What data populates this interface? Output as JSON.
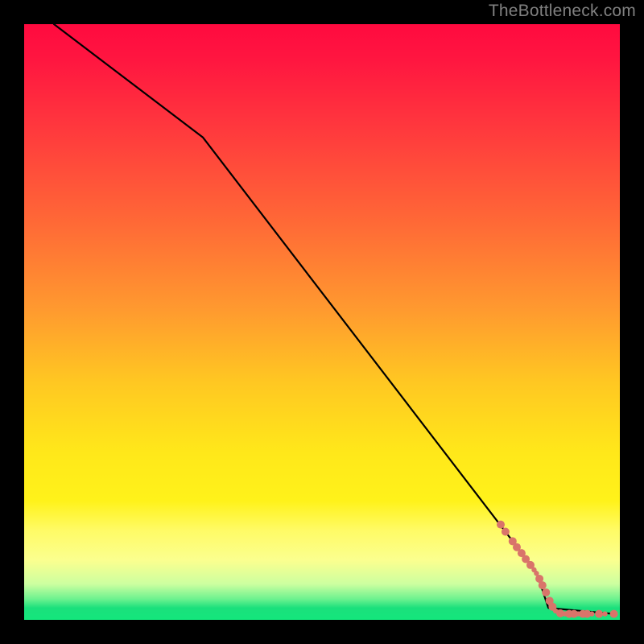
{
  "watermark": "TheBottleneck.com",
  "chart_data": {
    "type": "line",
    "title": "",
    "xlabel": "",
    "ylabel": "",
    "xlim": [
      0,
      100
    ],
    "ylim": [
      0,
      100
    ],
    "grid": false,
    "background_gradient": {
      "direction": "vertical",
      "stops": [
        {
          "pos": 0.0,
          "color": "#ff0a3f"
        },
        {
          "pos": 0.5,
          "color": "#ffb228"
        },
        {
          "pos": 0.8,
          "color": "#fff21a"
        },
        {
          "pos": 0.95,
          "color": "#a8ff9a"
        },
        {
          "pos": 1.0,
          "color": "#14e67c"
        }
      ]
    },
    "series": [
      {
        "name": "curve",
        "color": "#000000",
        "x": [
          5,
          30,
          86,
          88,
          99
        ],
        "y": [
          100,
          81,
          8,
          2,
          1
        ]
      }
    ],
    "scatter": {
      "name": "points",
      "color": "#d9746a",
      "radius_small": 3.2,
      "radius_large": 5.0,
      "points": [
        {
          "x": 80.0,
          "y": 16.0,
          "r": 5.0
        },
        {
          "x": 80.8,
          "y": 14.8,
          "r": 5.0
        },
        {
          "x": 82.0,
          "y": 13.2,
          "r": 5.0
        },
        {
          "x": 82.7,
          "y": 12.2,
          "r": 5.0
        },
        {
          "x": 83.5,
          "y": 11.2,
          "r": 5.0
        },
        {
          "x": 84.2,
          "y": 10.2,
          "r": 5.0
        },
        {
          "x": 85.0,
          "y": 9.2,
          "r": 5.0
        },
        {
          "x": 85.6,
          "y": 8.4,
          "r": 3.2
        },
        {
          "x": 86.0,
          "y": 7.8,
          "r": 3.2
        },
        {
          "x": 86.5,
          "y": 6.9,
          "r": 5.0
        },
        {
          "x": 87.0,
          "y": 5.8,
          "r": 5.0
        },
        {
          "x": 87.6,
          "y": 4.6,
          "r": 5.0
        },
        {
          "x": 88.2,
          "y": 3.2,
          "r": 5.0
        },
        {
          "x": 88.7,
          "y": 2.2,
          "r": 5.0
        },
        {
          "x": 89.2,
          "y": 1.5,
          "r": 3.2
        },
        {
          "x": 90.0,
          "y": 1.1,
          "r": 5.0
        },
        {
          "x": 90.8,
          "y": 1.0,
          "r": 3.2
        },
        {
          "x": 91.5,
          "y": 1.0,
          "r": 5.0
        },
        {
          "x": 92.3,
          "y": 1.0,
          "r": 5.0
        },
        {
          "x": 93.0,
          "y": 1.0,
          "r": 3.2
        },
        {
          "x": 93.8,
          "y": 1.0,
          "r": 5.0
        },
        {
          "x": 94.5,
          "y": 1.0,
          "r": 5.0
        },
        {
          "x": 95.3,
          "y": 1.0,
          "r": 3.2
        },
        {
          "x": 96.5,
          "y": 1.0,
          "r": 5.0
        },
        {
          "x": 97.5,
          "y": 1.0,
          "r": 3.2
        },
        {
          "x": 99.0,
          "y": 1.0,
          "r": 5.0
        }
      ]
    }
  }
}
